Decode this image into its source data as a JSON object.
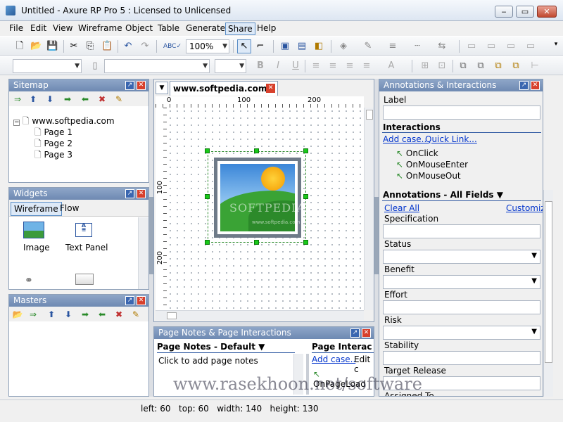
{
  "window": {
    "title": "Untitled - Axure RP Pro 5 : Licensed to Unlicensed",
    "min_glyph": "‒",
    "max_glyph": "▭",
    "close_glyph": "✕"
  },
  "menu": [
    {
      "label": "File"
    },
    {
      "label": "Edit"
    },
    {
      "label": "View"
    },
    {
      "label": "Wireframe"
    },
    {
      "label": "Object"
    },
    {
      "label": "Table"
    },
    {
      "label": "Generate"
    },
    {
      "label": "Share"
    },
    {
      "label": "Help"
    }
  ],
  "toolbar": {
    "zoom": "100%"
  },
  "sitemap": {
    "title": "Sitemap",
    "root": "www.softpedia.com",
    "pages": [
      "Page 1",
      "Page 2",
      "Page 3"
    ]
  },
  "widgets": {
    "title": "Widgets",
    "tabs": [
      "Wireframe",
      "Flow"
    ],
    "items": [
      "Image",
      "Text Panel"
    ]
  },
  "masters": {
    "title": "Masters"
  },
  "canvas": {
    "tab_label": "www.softpedia.com",
    "ruler_top": [
      "0",
      "100",
      "200"
    ],
    "ruler_left": [
      "100",
      "200"
    ],
    "watermark": "SOFTPEDIA",
    "watermark_small": "www.softpedia.com"
  },
  "page_notes": {
    "title": "Page Notes & Page Interactions",
    "notes_header": "Page Notes - Default",
    "notes_placeholder": "Click to add page notes",
    "interactions_header": "Page Interac",
    "add_case": "Add case..",
    "edit_case": "Edit c",
    "event": "OnPageLoad"
  },
  "annotations": {
    "title": "Annotations & Interactions",
    "label_field": "Label",
    "interactions_header": "Interactions",
    "add_case": "Add case..",
    "quick_link": "Quick Link...",
    "events": [
      "OnClick",
      "OnMouseEnter",
      "OnMouseOut"
    ],
    "fields_header": "Annotations - All Fields",
    "clear_all": "Clear All",
    "customize": "Customize",
    "fields": [
      "Specification",
      "Status",
      "Benefit",
      "Effort",
      "Risk",
      "Stability",
      "Target Release",
      "Assigned To"
    ]
  },
  "status": {
    "text": "left: 60   top: 60   width: 140   height: 130"
  },
  "overlay_watermark": "www.rasekhoon.net/software"
}
